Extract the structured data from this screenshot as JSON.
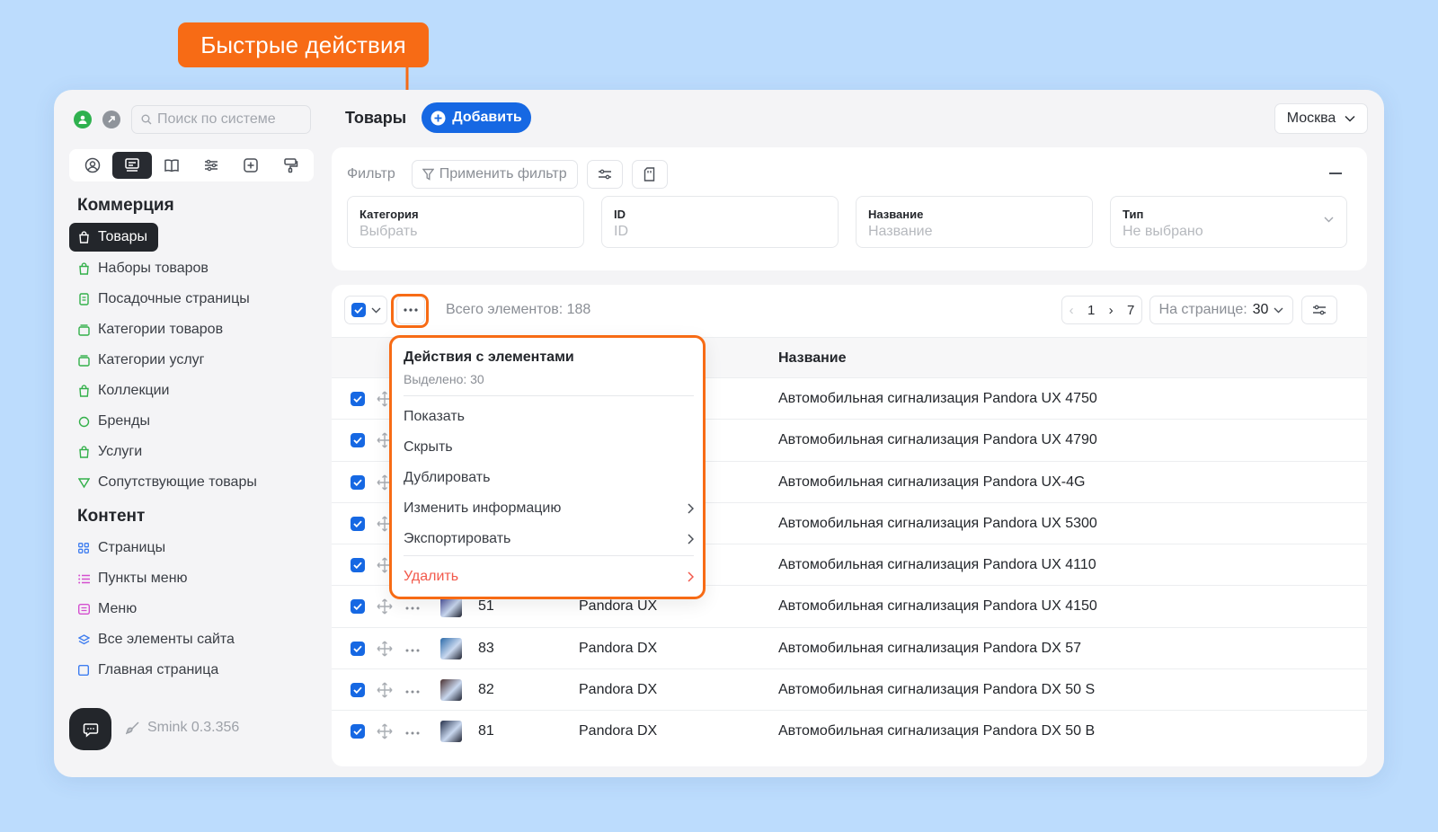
{
  "callout": {
    "label": "Быстрые действия"
  },
  "sidebar": {
    "search_placeholder": "Поиск по системе",
    "sections": {
      "commerce": "Коммерция",
      "content": "Контент"
    },
    "commerce_items": [
      {
        "label": "Товары",
        "icon": "bag-icon"
      },
      {
        "label": "Наборы товаров",
        "icon": "bag-icon"
      },
      {
        "label": "Посадочные страницы",
        "icon": "page-icon"
      },
      {
        "label": "Категории товаров",
        "icon": "folder-icon"
      },
      {
        "label": "Категории услуг",
        "icon": "folder-icon"
      },
      {
        "label": "Коллекции",
        "icon": "bag-icon"
      },
      {
        "label": "Бренды",
        "icon": "badge-icon"
      },
      {
        "label": "Услуги",
        "icon": "bag-icon"
      },
      {
        "label": "Сопутствующие товары",
        "icon": "link-icon"
      }
    ],
    "content_items": [
      {
        "label": "Страницы",
        "icon": "grid-icon"
      },
      {
        "label": "Пункты меню",
        "icon": "list-icon"
      },
      {
        "label": "Меню",
        "icon": "menu-icon"
      },
      {
        "label": "Все элементы сайта",
        "icon": "layers-icon"
      },
      {
        "label": "Главная страница",
        "icon": "square-icon"
      }
    ],
    "version": "Smink 0.3.356"
  },
  "header": {
    "title": "Товары",
    "add_label": "Добавить",
    "city": "Москва"
  },
  "filter": {
    "label": "Фильтр",
    "apply_label": "Применить фильтр",
    "fields": [
      {
        "label": "Категория",
        "placeholder": "Выбрать"
      },
      {
        "label": "ID",
        "placeholder": "ID"
      },
      {
        "label": "Название",
        "placeholder": "Название"
      },
      {
        "label": "Тип",
        "placeholder": "Не выбрано"
      }
    ]
  },
  "table": {
    "total_label": "Всего элементов: 188",
    "pager": {
      "current": "1",
      "total": "7"
    },
    "perpage_label": "На странице:",
    "perpage_value": "30",
    "column_name": "Название",
    "rows": [
      {
        "id": "",
        "brand": "",
        "name": "Автомобильная сигнализация Pandora UX 4750"
      },
      {
        "id": "",
        "brand": "",
        "name": "Автомобильная сигнализация Pandora UX 4790"
      },
      {
        "id": "",
        "brand": "",
        "name": "Автомобильная сигнализация Pandora UX-4G"
      },
      {
        "id": "",
        "brand": "",
        "name": "Автомобильная сигнализация Pandora UX 5300"
      },
      {
        "id": "",
        "brand": "",
        "name": "Автомобильная сигнализация Pandora UX 4110"
      },
      {
        "id": "51",
        "brand": "Pandora UX",
        "name": "Автомобильная сигнализация Pandora UX 4150"
      },
      {
        "id": "83",
        "brand": "Pandora DX",
        "name": "Автомобильная сигнализация Pandora DX 57"
      },
      {
        "id": "82",
        "brand": "Pandora DX",
        "name": "Автомобильная сигнализация Pandora DX 50 S"
      },
      {
        "id": "81",
        "brand": "Pandora DX",
        "name": "Автомобильная сигнализация Pandora DX 50 B"
      }
    ]
  },
  "menu": {
    "title": "Действия с элементами",
    "subtitle": "Выделено: 30",
    "items": [
      {
        "label": "Показать"
      },
      {
        "label": "Скрыть"
      },
      {
        "label": "Дублировать"
      },
      {
        "label": "Изменить информацию"
      },
      {
        "label": "Экспортировать"
      }
    ],
    "delete_label": "Удалить"
  },
  "colors": {
    "accent": "#1668e3",
    "highlight": "#f76b15",
    "danger": "#f2594b"
  }
}
